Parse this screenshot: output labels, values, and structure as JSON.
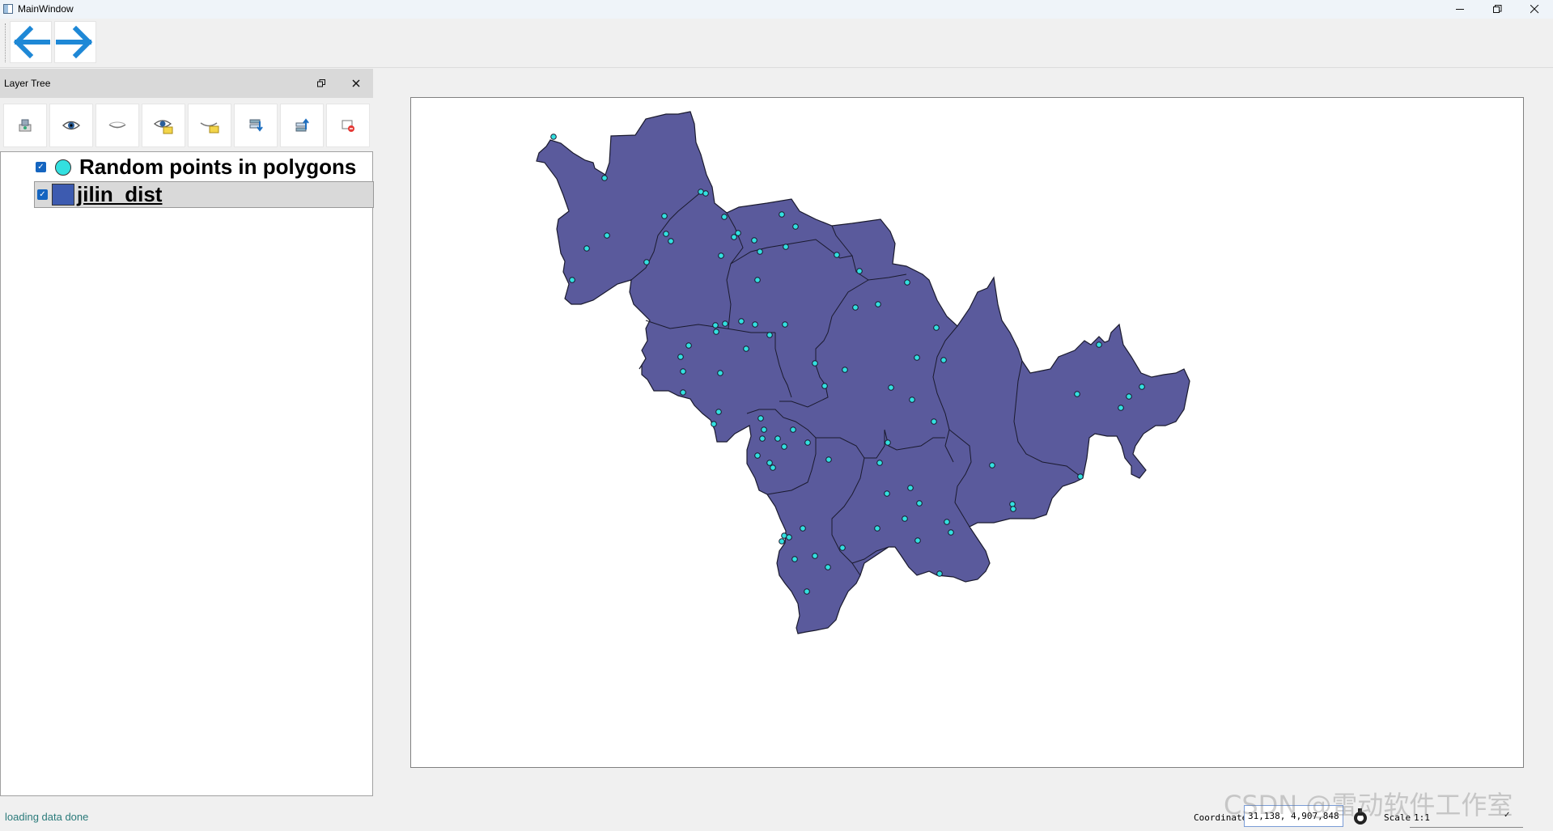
{
  "window": {
    "title": "MainWindow"
  },
  "toolbar": {
    "back_icon": "arrow-left-icon",
    "forward_icon": "arrow-right-icon",
    "accent": "#1e88d6"
  },
  "layer_panel": {
    "title": "Layer Tree",
    "tools": [
      {
        "name": "layer-properties-icon"
      },
      {
        "name": "show-layer-icon"
      },
      {
        "name": "hide-layer-icon"
      },
      {
        "name": "show-all-icon"
      },
      {
        "name": "hide-all-icon"
      },
      {
        "name": "move-down-icon"
      },
      {
        "name": "move-up-icon"
      },
      {
        "name": "remove-layer-icon"
      }
    ],
    "layers": [
      {
        "name": "Random points in polygons",
        "checked": true,
        "color": "#33e0e0"
      },
      {
        "name": "jilin_dist",
        "checked": true,
        "color": "#3d5bb0",
        "selected": true
      }
    ]
  },
  "map": {
    "fill_color": "#5a5a9c",
    "point_color": "#33e0e0"
  },
  "status": {
    "message": "loading data done",
    "coordinate_label": "Coordinate",
    "coordinate_value": "31,138, 4,907,848",
    "scale_label": "Scale",
    "scale_value": "1:1"
  },
  "watermark": "CSDN @雷动软件工作室"
}
